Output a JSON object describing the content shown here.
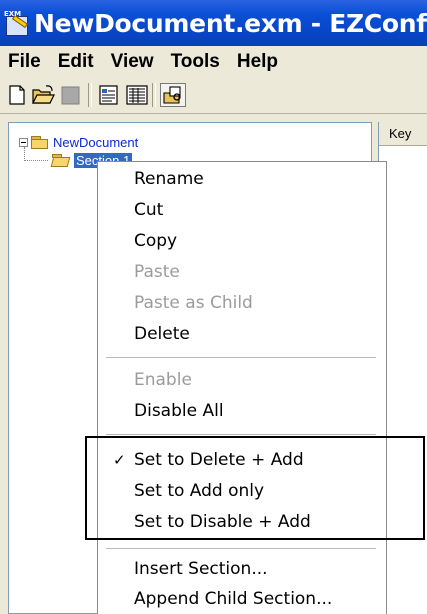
{
  "window": {
    "title": "NewDocument.exm - EZConfig",
    "icon_name": "app-icon",
    "icon_tag": "EXM"
  },
  "menubar": {
    "items": [
      {
        "label": "File"
      },
      {
        "label": "Edit"
      },
      {
        "label": "View"
      },
      {
        "label": "Tools"
      },
      {
        "label": "Help"
      }
    ]
  },
  "toolbar": {
    "buttons": [
      {
        "icon": "new-document-icon"
      },
      {
        "icon": "open-folder-icon"
      },
      {
        "icon": "save-icon",
        "disabled": true
      },
      {
        "icon": "properties-icon"
      },
      {
        "icon": "grid-view-icon"
      },
      {
        "icon": "preview-icon"
      }
    ]
  },
  "tree": {
    "root": {
      "label": "NewDocument",
      "icon": "folder-icon",
      "expanded": true
    },
    "children": [
      {
        "label": "Section 1",
        "icon": "open-folder-icon",
        "selected": true
      }
    ]
  },
  "list": {
    "header": "Key"
  },
  "context_menu": {
    "groups": [
      [
        {
          "label": "Rename",
          "enabled": true
        },
        {
          "label": "Cut",
          "enabled": true
        },
        {
          "label": "Copy",
          "enabled": true
        },
        {
          "label": "Paste",
          "enabled": false
        },
        {
          "label": "Paste as Child",
          "enabled": false
        },
        {
          "label": "Delete",
          "enabled": true
        }
      ],
      [
        {
          "label": "Enable",
          "enabled": false
        },
        {
          "label": "Disable All",
          "enabled": true
        }
      ],
      [
        {
          "label": "Set to Delete + Add",
          "enabled": true,
          "checked": true
        },
        {
          "label": "Set to Add only",
          "enabled": true
        },
        {
          "label": "Set to Disable + Add",
          "enabled": true
        }
      ],
      [
        {
          "label": "Insert Section...",
          "enabled": true
        },
        {
          "label": "Append Child Section...",
          "enabled": true
        }
      ]
    ],
    "check_glyph": "✓"
  },
  "colors": {
    "titlebar": "#0a4fd6",
    "selection": "#316ac5",
    "disabled_text": "#9b9b9b",
    "tree_link": "#0a2bd0"
  }
}
